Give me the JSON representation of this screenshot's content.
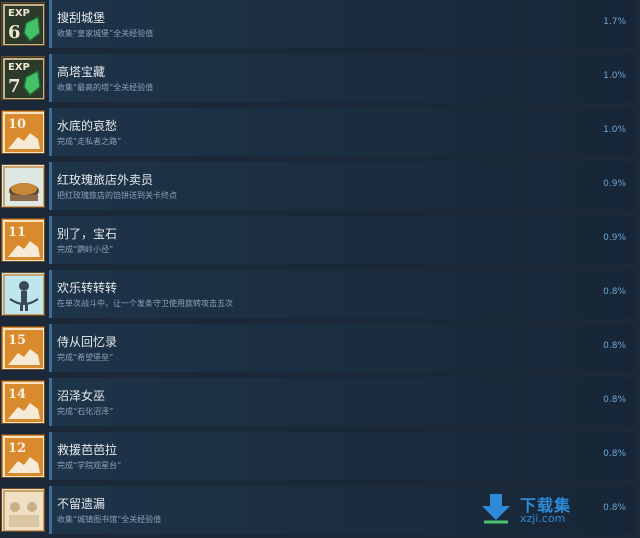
{
  "achievements": [
    {
      "icon": "exp-6-icon",
      "badge": "EXP\n6",
      "title": "搜刮城堡",
      "desc": "收集“皇家城堡”全关经验值",
      "percent": "1.7%"
    },
    {
      "icon": "exp-7-icon",
      "badge": "EXP\n7",
      "title": "高塔宝藏",
      "desc": "收集“最高的塔”全关经验值",
      "percent": "1.0%"
    },
    {
      "icon": "level-10-icon",
      "badge": "10",
      "title": "水底的哀愁",
      "desc": "完成“走私者之路”",
      "percent": "1.0%"
    },
    {
      "icon": "pie-icon",
      "badge": "",
      "title": "红玫瑰旅店外卖员",
      "desc": "把红玫瑰旅店的馅饼送到关卡终点",
      "percent": "0.9%"
    },
    {
      "icon": "level-11-icon",
      "badge": "11",
      "title": "别了，宝石",
      "desc": "完成“鹦岭小径”",
      "percent": "0.9%"
    },
    {
      "icon": "spin-knight-icon",
      "badge": "",
      "title": "欢乐转转转",
      "desc": "在单次战斗中，让一个发条守卫使用旋转攻击五次",
      "percent": "0.8%"
    },
    {
      "icon": "level-15-icon",
      "badge": "15",
      "title": "侍从回忆录",
      "desc": "完成“希望堡垒”",
      "percent": "0.8%"
    },
    {
      "icon": "level-14-icon",
      "badge": "14",
      "title": "沼泽女巫",
      "desc": "完成“石化沼泽”",
      "percent": "0.8%"
    },
    {
      "icon": "level-12-icon",
      "badge": "12",
      "title": "救援芭芭拉",
      "desc": "完成“学院观星台”",
      "percent": "0.8%"
    },
    {
      "icon": "library-icon",
      "badge": "",
      "title": "不留遗漏",
      "desc": "收集“城镇图书馆”全关经验值",
      "percent": "0.8%"
    }
  ],
  "watermark": {
    "name": "下载集",
    "url": "xzji.com",
    "icon": "download-arrow-icon"
  }
}
